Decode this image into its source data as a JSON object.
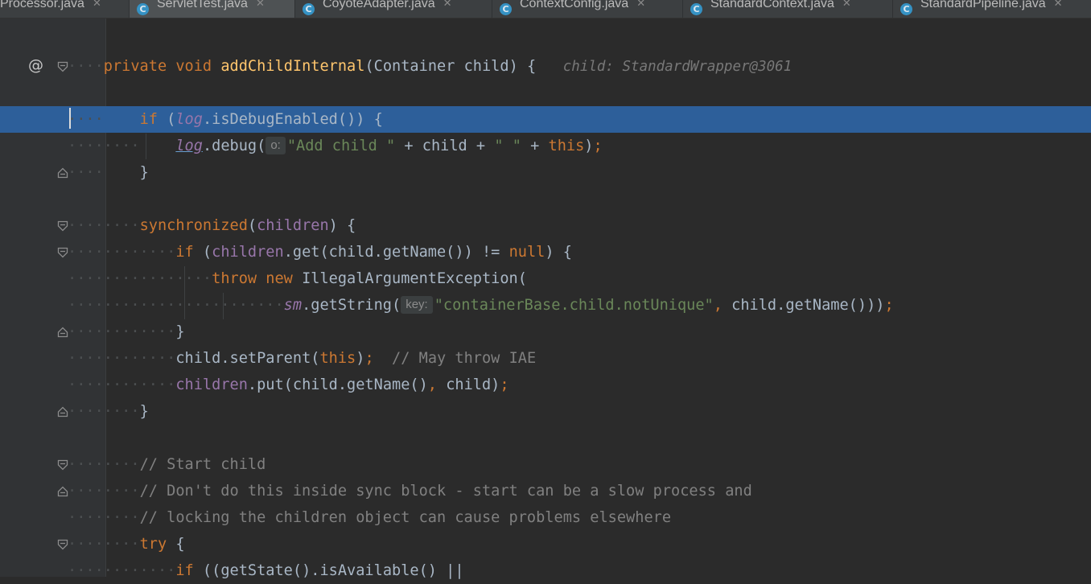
{
  "tabs": [
    {
      "label": "Processor.java",
      "icon": "C",
      "closable": true,
      "active": false
    },
    {
      "label": "ServletTest.java",
      "icon": "C",
      "closable": true,
      "active": true
    },
    {
      "label": "CoyoteAdapter.java",
      "icon": "C",
      "closable": true,
      "active": false
    },
    {
      "label": "ContextConfig.java",
      "icon": "C",
      "closable": true,
      "active": false
    },
    {
      "label": "StandardContext.java",
      "icon": "C",
      "closable": true,
      "active": false
    },
    {
      "label": "StandardPipeline.java",
      "icon": "C",
      "closable": true,
      "active": false
    }
  ],
  "gutter": {
    "override_marker": "@"
  },
  "code": {
    "method_decl": {
      "modifiers": "private void",
      "name": "addChildInternal",
      "params": "(Container child) {",
      "inlay": "child: StandardWrapper@3061"
    },
    "l_if_debug": {
      "kw": "if",
      "open": "(",
      "field": "log",
      "rest": ".isDebugEnabled()) {"
    },
    "l_debug_call": {
      "field": "log",
      "method": ".debug(",
      "hint": "o:",
      "str1": "\"Add child \"",
      "mid": " + child + ",
      "str2": "\" \"",
      "plus": " + ",
      "kw": "this",
      "close": ")",
      "semi": ";"
    },
    "l_close1": "}",
    "l_sync": {
      "kw": "synchronized",
      "open": "(",
      "field": "children",
      "close": ") {"
    },
    "l_if_get": {
      "kw": "if",
      "open": " (",
      "field": "children",
      "mid": ".get(child.getName()) != ",
      "kw2": "null",
      "close": ") {"
    },
    "l_throw": {
      "kw": "throw new",
      "rest": " IllegalArgumentException("
    },
    "l_getstring": {
      "field": "sm",
      "method": ".getString(",
      "hint": "key:",
      "str": "\"containerBase.child.notUnique\"",
      "comma": ",",
      "rest": " child.getName()))",
      "semi": ";"
    },
    "l_close2": "}",
    "l_setparent": {
      "pre": "child.setParent(",
      "kw": "this",
      "close": ")",
      "semi": ";",
      "cmt": "  // May throw IAE"
    },
    "l_put": {
      "field": "children",
      "mid": ".put(child.getName()",
      "comma": ",",
      "rest": " child)",
      "semi": ";"
    },
    "l_close3": "}",
    "l_cmt1": "// Start child",
    "l_cmt2": "// Don't do this inside sync block - start can be a slow process and",
    "l_cmt3": "// locking the children object can cause problems elsewhere",
    "l_try": {
      "kw": "try",
      "rest": " {"
    },
    "l_if_state": {
      "kw": "if",
      "rest": " ((getState().isAvailable() ||"
    }
  }
}
